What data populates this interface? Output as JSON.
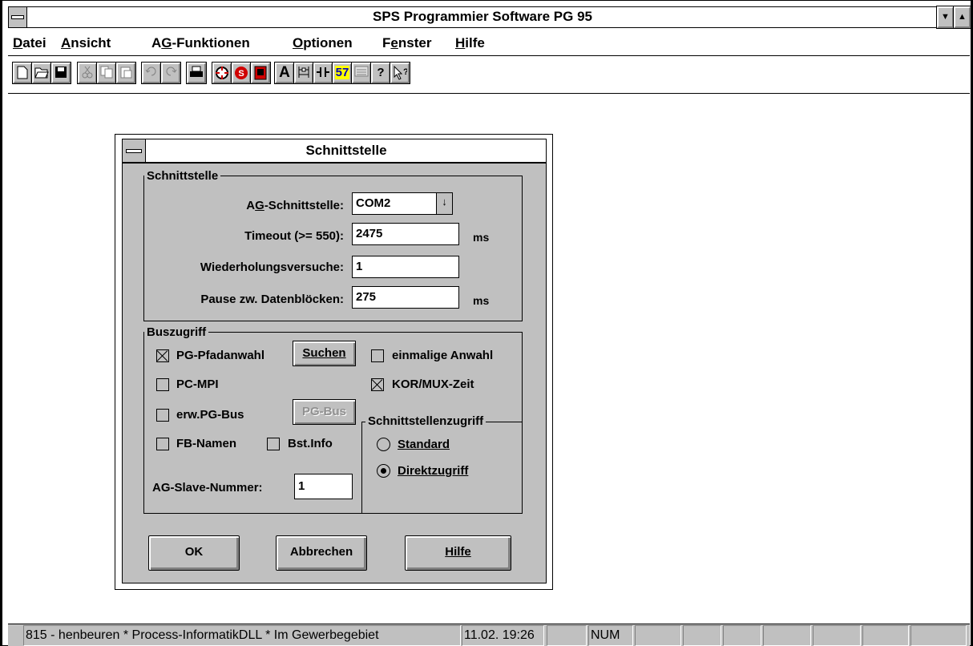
{
  "window": {
    "title": "SPS Programmier Software PG 95",
    "minimize_glyph": "▼",
    "maximize_glyph": "▲"
  },
  "menubar": {
    "items": [
      {
        "label": "Datei"
      },
      {
        "label": "Ansicht"
      },
      {
        "label": "AG-Funktionen"
      },
      {
        "label": "Optionen"
      },
      {
        "label": "Fenster"
      },
      {
        "label": "Hilfe"
      }
    ]
  },
  "toolbar": {
    "buttons": [
      {
        "icon": "new-file-icon"
      },
      {
        "icon": "open-folder-icon"
      },
      {
        "icon": "save-icon"
      },
      {
        "icon": "cut-icon",
        "disabled": true
      },
      {
        "icon": "copy-icon",
        "disabled": true
      },
      {
        "icon": "paste-icon",
        "disabled": true
      },
      {
        "icon": "undo-icon",
        "disabled": true
      },
      {
        "icon": "redo-icon",
        "disabled": true
      },
      {
        "icon": "print-icon"
      },
      {
        "icon": "online-icon"
      },
      {
        "icon": "stop-icon"
      },
      {
        "icon": "plc-icon"
      },
      {
        "icon": "text-a-icon",
        "glyph": "A"
      },
      {
        "icon": "ladder-icon"
      },
      {
        "icon": "contact-icon"
      },
      {
        "icon": "s7-icon",
        "glyph": "57"
      },
      {
        "icon": "list-icon"
      },
      {
        "icon": "help-icon",
        "glyph": "?"
      },
      {
        "icon": "context-help-icon"
      }
    ]
  },
  "dialog": {
    "title": "Schnittstelle",
    "group_interface": {
      "label": "Schnittstelle",
      "ag_interface_label": "AG-Schnittstelle:",
      "ag_interface_value": "COM2",
      "timeout_label": "Timeout (>= 550):",
      "timeout_value": "2475",
      "timeout_unit": "ms",
      "retries_label": "Wiederholungsversuche:",
      "retries_value": "1",
      "pause_label": "Pause zw. Datenblöcken:",
      "pause_value": "275",
      "pause_unit": "ms"
    },
    "group_bus": {
      "label": "Buszugriff",
      "pg_path_label": "PG-Pfadanwahl",
      "pg_path_checked": true,
      "search_button": "Suchen",
      "single_select_label": "einmalige Anwahl",
      "single_select_checked": false,
      "pc_mpi_label": "PC-MPI",
      "pc_mpi_checked": false,
      "kor_mux_label": "KOR/MUX-Zeit",
      "kor_mux_checked": true,
      "ext_pg_bus_label": "erw.PG-Bus",
      "ext_pg_bus_checked": false,
      "pg_bus_button": "PG-Bus",
      "fb_names_label": "FB-Namen",
      "fb_names_checked": false,
      "bst_info_label": "Bst.Info",
      "bst_info_checked": false,
      "slave_label": "AG-Slave-Nummer:",
      "slave_value": "1"
    },
    "group_access": {
      "label": "Schnittstellenzugriff",
      "standard_label": "Standard",
      "direct_label": "Direktzugriff",
      "selected": "Direktzugriff"
    },
    "buttons": {
      "ok": "OK",
      "cancel": "Abbrechen",
      "help": "Hilfe"
    }
  },
  "statusbar": {
    "message": "815 - henbeuren  * Process-InformatikDLL * Im Gewerbegebiet",
    "datetime": "11.02. 19:26",
    "num": "NUM"
  }
}
